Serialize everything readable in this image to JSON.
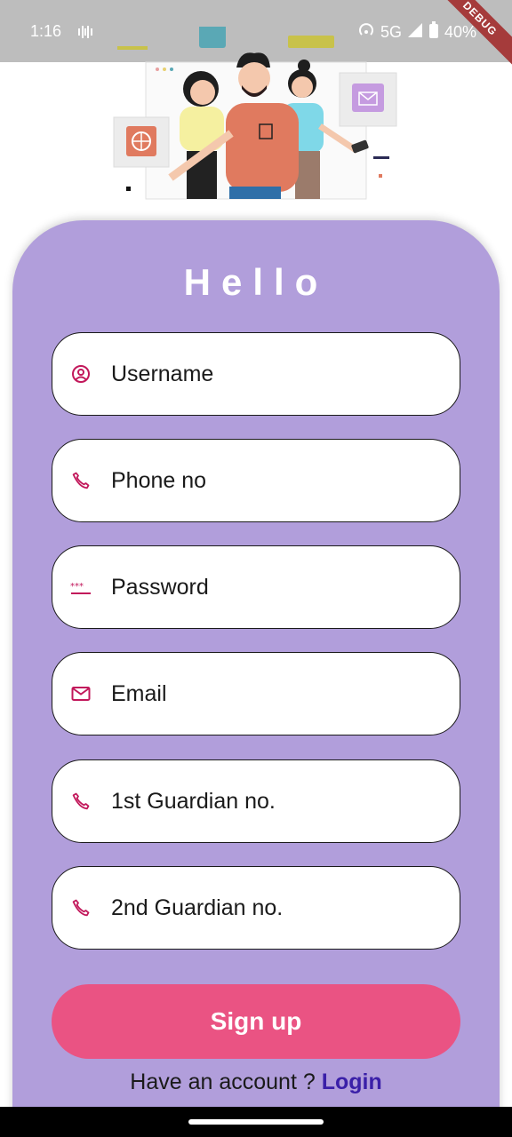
{
  "status_bar": {
    "time": "1:16",
    "network": "5G",
    "battery": "40%",
    "debug_label": "DEBUG"
  },
  "form": {
    "title": "Hello",
    "fields": [
      {
        "placeholder": "Username",
        "icon": "account-circle-icon"
      },
      {
        "placeholder": "Phone no",
        "icon": "phone-icon"
      },
      {
        "placeholder": "Password",
        "icon": "password-icon"
      },
      {
        "placeholder": "Email",
        "icon": "email-icon"
      },
      {
        "placeholder": "1st Guardian no.",
        "icon": "phone-icon"
      },
      {
        "placeholder": "2nd Guardian no.",
        "icon": "phone-icon"
      }
    ],
    "signup_label": "Sign up",
    "login_prompt": "Have an account ?",
    "login_label": "Login"
  },
  "colors": {
    "card_bg": "#b19edb",
    "accent": "#ea5383",
    "icon": "#c2185b",
    "link": "#3a1fa8",
    "status_bar": "#bdbdbd"
  }
}
